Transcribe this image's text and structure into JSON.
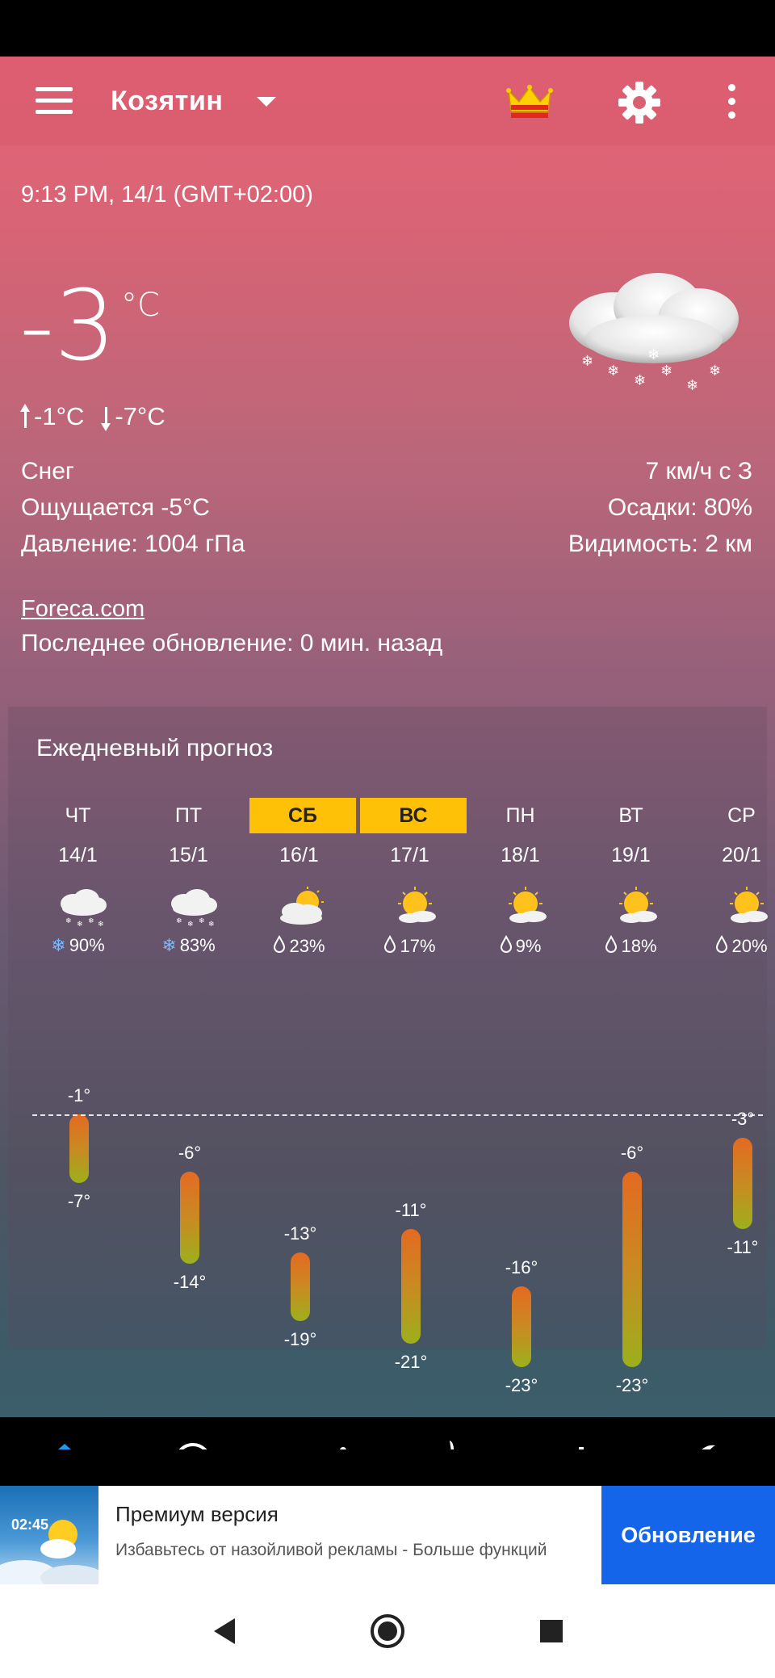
{
  "toolbar": {
    "city": "Козятин",
    "icons": [
      "menu-icon",
      "city-dropdown-icon",
      "crown-icon",
      "gear-icon",
      "more-vert-icon"
    ]
  },
  "current": {
    "time": "9:13 PM, 14/1 (GMT+02:00)",
    "temperature": "-3",
    "unit": "°C",
    "high": "-1°C",
    "low": "-7°C",
    "condition": "Снег",
    "feels_like": "Ощущается -5°C",
    "pressure": "Давление: 1004 гПа",
    "wind": "7 км/ч с З",
    "precipitation": "Осадки: 80%",
    "visibility": "Видимость: 2 км",
    "icon": "snow-cloud-icon"
  },
  "source": {
    "link": "Foreca.com",
    "updated": "Последнее обновление: 0 мин. назад"
  },
  "daily": {
    "title": "Ежедневный прогноз",
    "days": [
      {
        "name": "ЧТ",
        "date": "14/1",
        "weekend": false,
        "icon": "snow-cloud-icon",
        "precip_type": "snow",
        "precip": "90%",
        "high": "-1°",
        "low": "-7°",
        "hi": -1,
        "lo": -7
      },
      {
        "name": "ПТ",
        "date": "15/1",
        "weekend": false,
        "icon": "snow-cloud-icon",
        "precip_type": "snow",
        "precip": "83%",
        "high": "-6°",
        "low": "-14°",
        "hi": -6,
        "lo": -14
      },
      {
        "name": "СБ",
        "date": "16/1",
        "weekend": true,
        "icon": "partly-cloudy-icon",
        "precip_type": "rain",
        "precip": "23%",
        "high": "-13°",
        "low": "-19°",
        "hi": -13,
        "lo": -19
      },
      {
        "name": "ВС",
        "date": "17/1",
        "weekend": true,
        "icon": "sun-cloud-icon",
        "precip_type": "rain",
        "precip": "17%",
        "high": "-11°",
        "low": "-21°",
        "hi": -11,
        "lo": -21
      },
      {
        "name": "ПН",
        "date": "18/1",
        "weekend": false,
        "icon": "sun-cloud-icon",
        "precip_type": "rain",
        "precip": "9%",
        "high": "-16°",
        "low": "-23°",
        "hi": -16,
        "lo": -23
      },
      {
        "name": "ВТ",
        "date": "19/1",
        "weekend": false,
        "icon": "sun-cloud-icon",
        "precip_type": "rain",
        "precip": "18%",
        "high": "-6°",
        "low": "-23°",
        "hi": -6,
        "lo": -23
      },
      {
        "name": "СР",
        "date": "20/1",
        "weekend": false,
        "icon": "sun-cloud-icon",
        "precip_type": "rain",
        "precip": "20%",
        "high": "-3°",
        "low": "-11°",
        "hi": -3,
        "lo": -11
      }
    ]
  },
  "bottom_nav": [
    "home-icon",
    "clock-icon",
    "graph-icon",
    "wind-turbine-icon",
    "bars-icon",
    "moon-icon"
  ],
  "ad": {
    "thumb_time": "02:45",
    "title": "Премиум версия",
    "subtitle": "Избавьтесь от назойливой рекламы - Больше функций",
    "button": "Обновление"
  },
  "colors": {
    "accent_home": "#2196f3",
    "weekend": "#ffc107",
    "ad_button": "#1565ea"
  }
}
